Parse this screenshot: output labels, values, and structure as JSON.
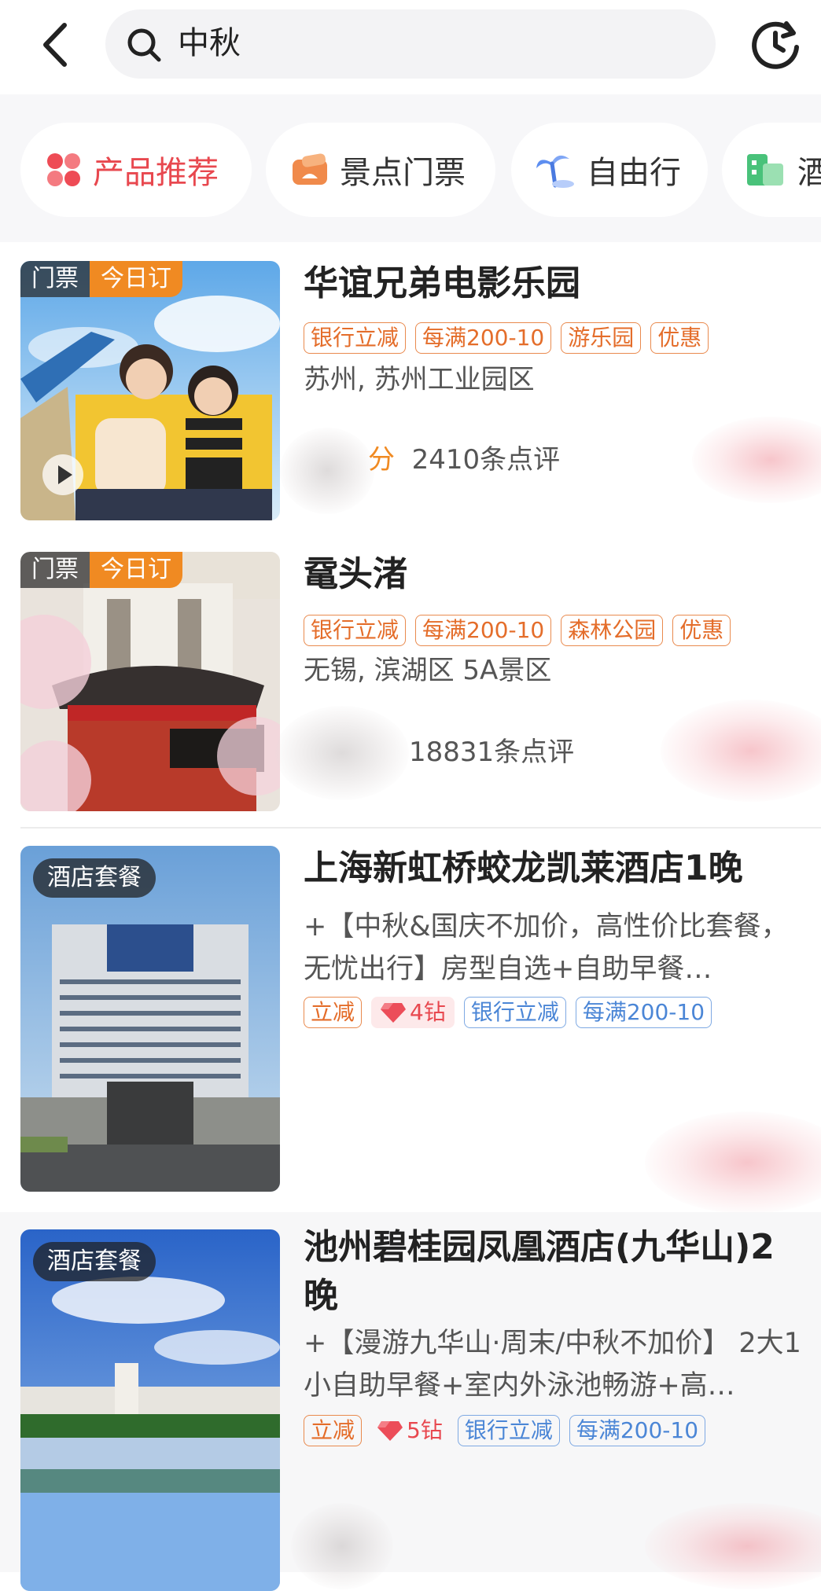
{
  "header": {
    "search_value": "中秋"
  },
  "tabs": [
    {
      "label": "产品推荐",
      "icon": "clover-icon",
      "active": true
    },
    {
      "label": "景点门票",
      "icon": "ticket-icon",
      "active": false
    },
    {
      "label": "自由行",
      "icon": "palm-tree-icon",
      "active": false
    },
    {
      "label": "酒",
      "icon": "hotel-icon",
      "active": false
    }
  ],
  "products": [
    {
      "badge_type": "门票",
      "badge_today": "今日订",
      "title": "华谊兄弟电影乐园",
      "tags": [
        "银行立减",
        "每满200-10",
        "游乐园",
        "优惠"
      ],
      "location": "苏州, 苏州工业园区",
      "score_unit": "分",
      "reviews": "2410条点评"
    },
    {
      "badge_type": "门票",
      "badge_today": "今日订",
      "title": "鼋头渚",
      "tags": [
        "银行立减",
        "每满200-10",
        "森林公园",
        "优惠"
      ],
      "location": "无锡, 滨湖区  5A景区",
      "reviews": "18831条点评"
    },
    {
      "badge_type": "酒店套餐",
      "title": "上海新虹桥蛟龙凯莱酒店1晚",
      "desc": "+【中秋&国庆不加价，高性价比套餐，无忧出行】房型自选+自助早餐…",
      "tags": [
        "立减",
        "4钻",
        "银行立减",
        "每满200-10"
      ]
    },
    {
      "badge_type": "酒店套餐",
      "title": "池州碧桂园凤凰酒店(九华山)2晚",
      "desc": "+【漫游九华山·周末/中秋不加价】 2大1小自助早餐+室内外泳池畅游+高…",
      "tags": [
        "立减",
        "5钻",
        "银行立减",
        "每满200-10"
      ]
    }
  ],
  "colors": {
    "accent_red": "#e8484f",
    "tag_orange": "#e46d2a",
    "tag_blue": "#4b86d6",
    "badge_orange": "#f08a22"
  }
}
